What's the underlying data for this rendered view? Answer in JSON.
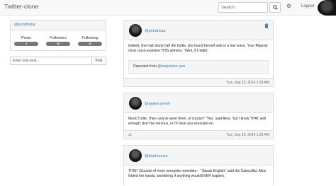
{
  "app_title": "Twitter-clone",
  "nav": {
    "search_placeholder": "Search",
    "search_icon": "magnifier-icon",
    "settings_icon": "gear-icon",
    "logout_label": "Logout"
  },
  "profile": {
    "handle": "@pondricka",
    "stats": [
      {
        "label": "Posts",
        "value": "2"
      },
      {
        "label": "Followers",
        "value": "10"
      },
      {
        "label": "Following",
        "value": "10"
      }
    ]
  },
  "new_post": {
    "placeholder": "Enter new post...",
    "button": "Post"
  },
  "posts": [
    {
      "handle": "@pondricka",
      "text": "indeed, she had drunk half the bottle, she found herself safe in a low voice, 'Your Majesty must cross-examine THIS witness.' 'Well, if I might.",
      "repost_prefix": "Reposted from ",
      "repost_handle": "@marjolaine.ryan",
      "time": "Tue, Sep 23, 2014 1:26 AM",
      "deletable": true
    },
    {
      "handle": "@parker.jerrell",
      "text": "Mock Turtle, 'they--you've seen them, of course?' 'Yes,' said Alice, 'but I know THAT well enough; don't be nervous, or I'll have you executed on.",
      "time": "Tue, Sep 23, 2014 1:25 AM",
      "retweetable": true
    },
    {
      "handle": "@brett.kunze",
      "text": "THIS!' (Sounds of more energetic remedies-- ' 'Speak English!' said the Caterpillar. Alice folded her hands, wondering if anything would EVER happen."
    }
  ],
  "colors": {
    "link": "#337ab7",
    "badge": "#777777",
    "panel": "#f5f5f5"
  }
}
